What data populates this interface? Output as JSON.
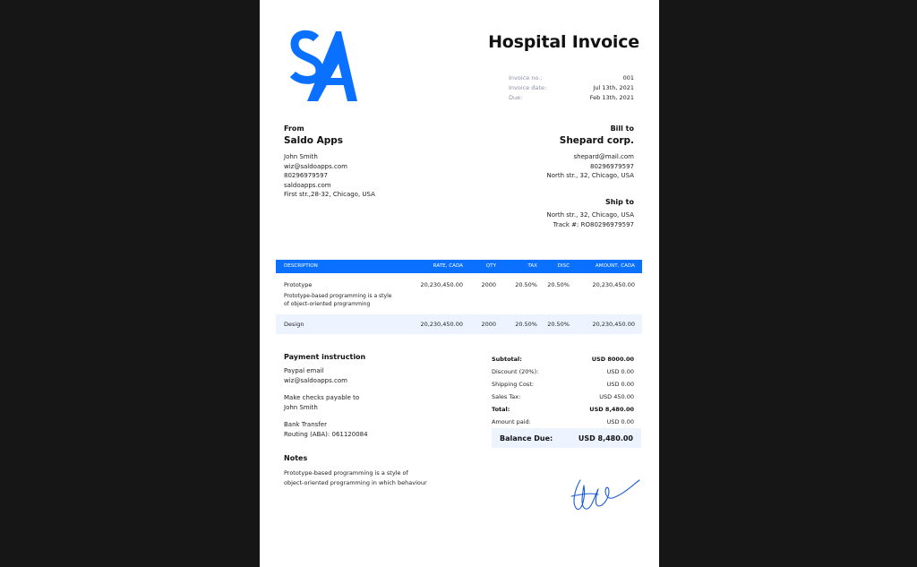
{
  "invoice": {
    "logo_text": "SA",
    "title": "Hospital Invoice",
    "meta": [
      {
        "label": "Invoice no.:",
        "value": "001"
      },
      {
        "label": "Invoice date:",
        "value": "Jul 13th, 2021"
      },
      {
        "label": "Due:",
        "value": "Feb 13th, 2021"
      }
    ],
    "from": {
      "heading": "From",
      "company": "Saldo Apps",
      "lines": [
        "John Smith",
        "wiz@saldoapps.com",
        "80296979597",
        "saldoapps.com",
        "First str.,28-32, Chicago, USA"
      ]
    },
    "bill_to": {
      "heading": "Bill to",
      "company": "Shepard corp.",
      "lines": [
        "shepard@mail.com",
        "80296979597",
        "North str., 32, Chicago, USA"
      ]
    },
    "ship_to": {
      "heading": "Ship to",
      "lines": [
        "North str., 32, Chicago, USA",
        "Track #: RO80296979597"
      ]
    },
    "table": {
      "headers": [
        "DESCRIPTION",
        "RATE, CADA",
        "QTY",
        "TAX",
        "DISC",
        "AMOUNT, CADA"
      ],
      "rows": [
        {
          "description": "Prototype",
          "note_1": "Prototype-based programming is a style",
          "note_2": "of object-oriented programming",
          "rate": "20,230,450.00",
          "qty": "2000",
          "tax": "20.50%",
          "disc": "20.50%",
          "amount": "20,230,450.00"
        },
        {
          "description": "Design",
          "rate": "20,230,450.00",
          "qty": "2000",
          "tax": "20.50%",
          "disc": "20.50%",
          "amount": "20,230,450.00"
        }
      ]
    },
    "payment": {
      "heading": "Payment instruction",
      "lines": [
        "Paypal email",
        "wiz@saldoapps.com",
        "Make checks payable to",
        "John Smith",
        "Bank Transfer",
        "Routing (ABA): 061120084"
      ]
    },
    "summary": [
      {
        "label": "Subtotal:",
        "value": "USD 8000.00"
      },
      {
        "label": "Discount (20%):",
        "value": "USD 0.00"
      },
      {
        "label": "Shipping Cost:",
        "value": "USD 0.00"
      },
      {
        "label": "Sales Tax:",
        "value": "USD 450.00"
      },
      {
        "label": "Total:",
        "value": "USD 8,480.00"
      },
      {
        "label": "Amount paid:",
        "value": "USD 0.00"
      }
    ],
    "balance_due": {
      "label": "Balance Due:",
      "value": "USD 8,480.00"
    },
    "notes": {
      "heading": "Notes",
      "lines": [
        "Prototype-based programming is a style of",
        "object-oriented programming in which behaviour"
      ]
    },
    "colors": {
      "accent": "#0a70ff",
      "light_fill": "#eef4ff",
      "backdrop": "#161616"
    }
  }
}
